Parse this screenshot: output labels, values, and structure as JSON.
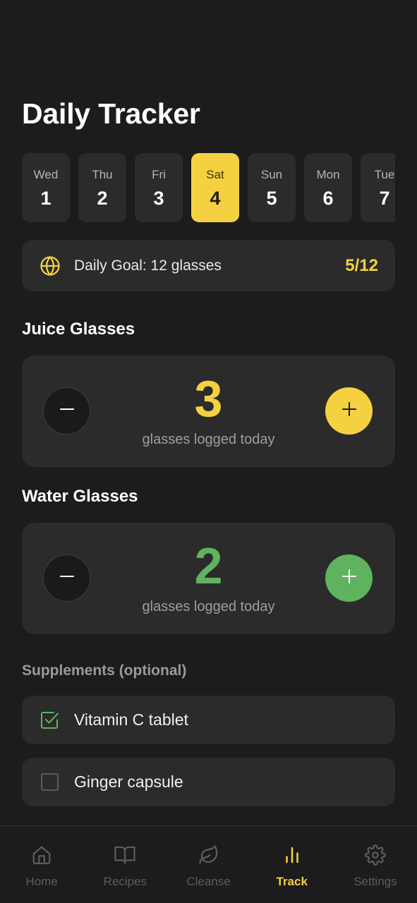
{
  "header": {
    "title": "Daily Tracker"
  },
  "days": [
    {
      "name": "Wed",
      "num": "1",
      "active": false
    },
    {
      "name": "Thu",
      "num": "2",
      "active": false
    },
    {
      "name": "Fri",
      "num": "3",
      "active": false
    },
    {
      "name": "Sat",
      "num": "4",
      "active": true
    },
    {
      "name": "Sun",
      "num": "5",
      "active": false
    },
    {
      "name": "Mon",
      "num": "6",
      "active": false
    },
    {
      "name": "Tue",
      "num": "7",
      "active": false
    }
  ],
  "goal": {
    "label": "Daily Goal: 12 glasses",
    "progress": "5/12",
    "icon": "globe-icon"
  },
  "juice": {
    "title": "Juice Glasses",
    "count": "3",
    "label": "glasses logged today",
    "accent": "#f5d142"
  },
  "water": {
    "title": "Water Glasses",
    "count": "2",
    "label": "glasses logged today",
    "accent": "#5fb35f"
  },
  "supplements": {
    "title": "Supplements (optional)",
    "items": [
      {
        "label": "Vitamin C tablet",
        "checked": true
      },
      {
        "label": "Ginger capsule",
        "checked": false
      }
    ]
  },
  "nav": {
    "items": [
      {
        "label": "Home",
        "icon": "home-icon",
        "active": false
      },
      {
        "label": "Recipes",
        "icon": "book-icon",
        "active": false
      },
      {
        "label": "Cleanse",
        "icon": "leaf-icon",
        "active": false
      },
      {
        "label": "Track",
        "icon": "bar-chart-icon",
        "active": true
      },
      {
        "label": "Settings",
        "icon": "gear-icon",
        "active": false
      }
    ]
  },
  "colors": {
    "background": "#1c1c1c",
    "card": "#2b2b2b",
    "accent_yellow": "#f5d142",
    "accent_green": "#5fb35f"
  }
}
